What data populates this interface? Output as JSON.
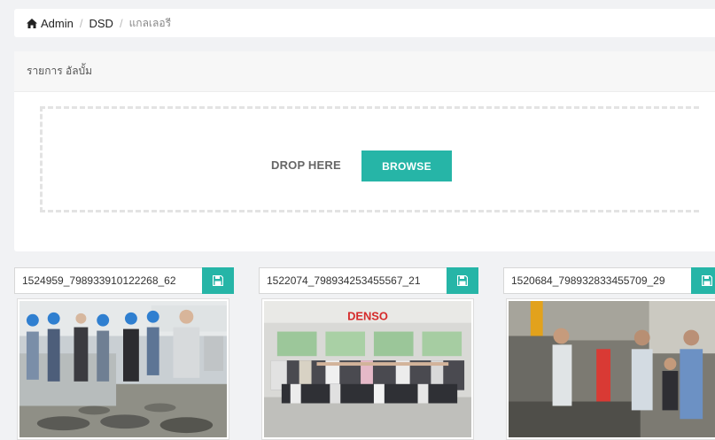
{
  "breadcrumb": {
    "home_icon": "home-icon",
    "items": [
      "Admin",
      "DSD",
      "แกลเลอรี"
    ]
  },
  "panel": {
    "title": "รายการ อัลบั้ม",
    "drop_label": "DROP HERE",
    "browse_label": "BROWSE"
  },
  "gallery": {
    "items": [
      {
        "filename": "1524959_798933910122268_62",
        "save_icon": "save-icon"
      },
      {
        "filename": "1522074_798934253455567_21",
        "save_icon": "save-icon"
      },
      {
        "filename": "1520684_798932833455709_29",
        "save_icon": "save-icon"
      }
    ],
    "photo2_sign": "DENSO"
  },
  "colors": {
    "accent": "#26b5a7",
    "page_bg": "#f1f2f4",
    "card_bg": "#ffffff"
  }
}
